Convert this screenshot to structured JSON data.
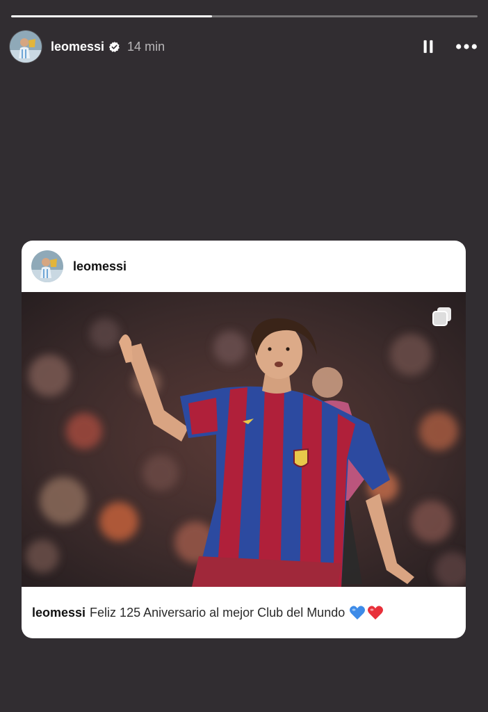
{
  "story": {
    "progress": 0.43,
    "username": "leomessi",
    "timestamp": "14 min",
    "verified": true,
    "icons": {
      "verified": "verified-badge-icon",
      "pause": "pause-icon",
      "more": "more-icon"
    }
  },
  "post": {
    "username": "leomessi",
    "caption_user": "leomessi",
    "caption_text": "Feliz 125 Aniversario al mejor Club del Mundo",
    "emojis": [
      "blue-heart",
      "red-heart"
    ],
    "carousel": true
  },
  "colors": {
    "background": "#312d31",
    "card": "#ffffff",
    "blue_heart": "#3d8be8",
    "red_heart": "#e8303a",
    "barca_blue": "#2c4aa0",
    "barca_red": "#b0203a"
  }
}
